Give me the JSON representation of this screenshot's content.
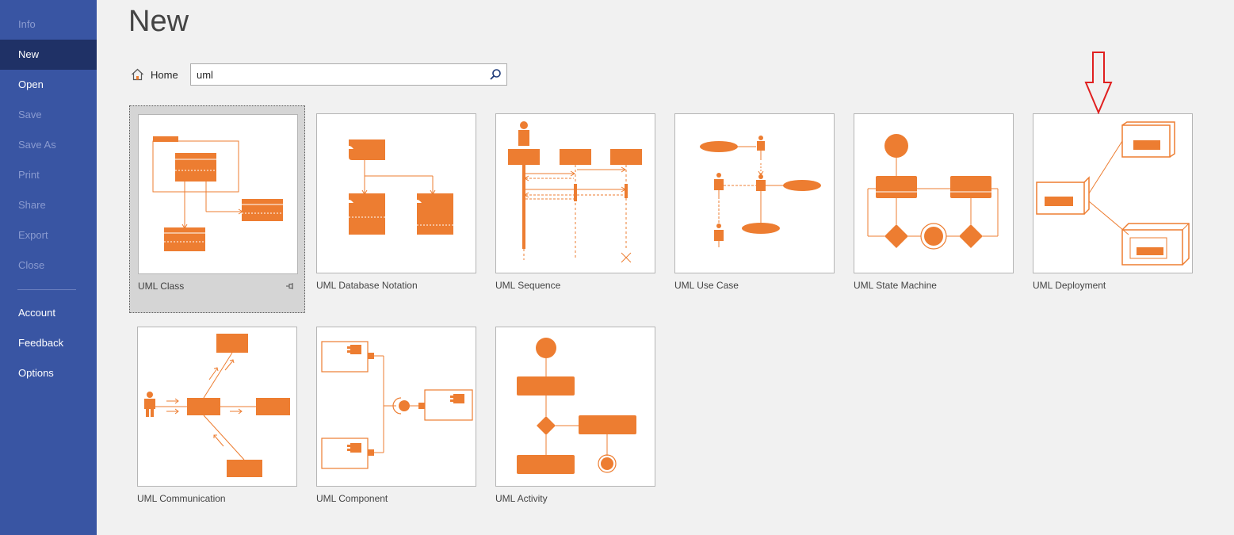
{
  "sidebar": {
    "items": [
      {
        "label": "Info",
        "state": "disabled"
      },
      {
        "label": "New",
        "state": "selected"
      },
      {
        "label": "Open",
        "state": "enabled"
      },
      {
        "label": "Save",
        "state": "disabled"
      },
      {
        "label": "Save As",
        "state": "disabled"
      },
      {
        "label": "Print",
        "state": "disabled"
      },
      {
        "label": "Share",
        "state": "disabled"
      },
      {
        "label": "Export",
        "state": "disabled"
      },
      {
        "label": "Close",
        "state": "disabled"
      },
      {
        "label": "Account",
        "state": "enabled"
      },
      {
        "label": "Feedback",
        "state": "enabled"
      },
      {
        "label": "Options",
        "state": "enabled"
      }
    ]
  },
  "main": {
    "title": "New",
    "home_label": "Home",
    "search": {
      "value": "uml",
      "icon": "search-icon"
    },
    "templates": [
      {
        "label": "UML Class",
        "selected": true,
        "pinned": true
      },
      {
        "label": "UML Database Notation"
      },
      {
        "label": "UML Sequence"
      },
      {
        "label": "UML Use Case"
      },
      {
        "label": "UML State Machine"
      },
      {
        "label": "UML Deployment"
      },
      {
        "label": "UML Communication"
      },
      {
        "label": "UML Component"
      },
      {
        "label": "UML Activity"
      }
    ]
  },
  "colors": {
    "accent": "#ed7d31",
    "sidebar_bg": "#3955a3",
    "sidebar_selected": "#1f3166",
    "annotation_arrow": "#e02020"
  }
}
